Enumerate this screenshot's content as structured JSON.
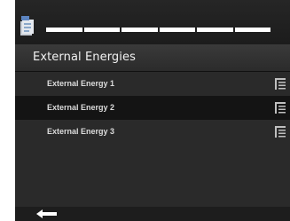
{
  "header": {
    "icon": "document-stack-icon",
    "progress": {
      "total_steps": 6,
      "completed_steps": 6
    }
  },
  "page": {
    "title": "External Energies"
  },
  "list": {
    "items": [
      {
        "label": "External Energy 1",
        "icon": "list-menu-icon",
        "selected": false
      },
      {
        "label": "External Energy 2",
        "icon": "list-menu-icon",
        "selected": true
      },
      {
        "label": "External Energy 3",
        "icon": "list-menu-icon",
        "selected": false
      }
    ]
  },
  "footer": {
    "back_icon": "back-arrow-icon"
  },
  "colors": {
    "background": "#1b1b1b",
    "title_bar": "#333333",
    "list_background": "#2a2a2a",
    "selected_row": "#141414",
    "text": "#dcdcdc"
  }
}
